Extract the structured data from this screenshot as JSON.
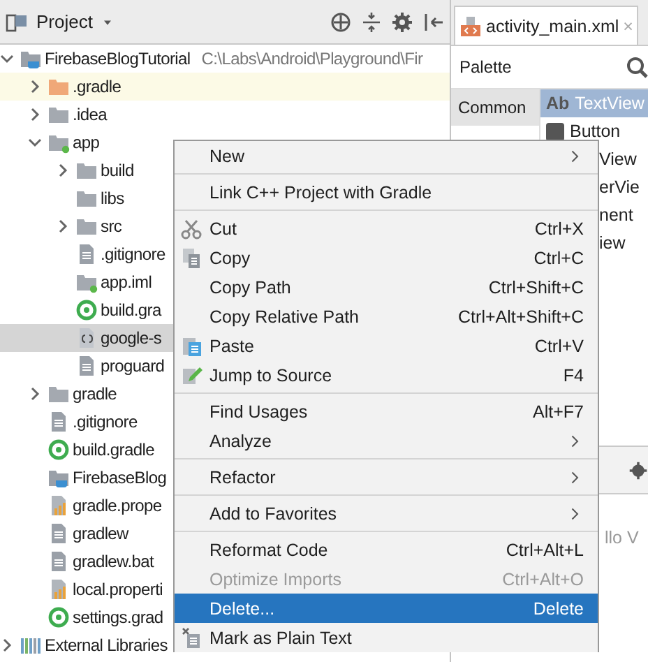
{
  "project_panel": {
    "title": "Project",
    "tree": [
      {
        "kind": "project",
        "label": "FirebaseBlogTutorial",
        "path": "C:\\Labs\\Android\\Playground\\Fir",
        "expanded": true,
        "selected": false,
        "highlighted": false,
        "children": [
          {
            "kind": "excluded-folder",
            "label": ".gradle",
            "expanded": false,
            "selected": false,
            "highlighted": true
          },
          {
            "kind": "folder",
            "label": ".idea",
            "expanded": false,
            "selected": false,
            "highlighted": false
          },
          {
            "kind": "module",
            "label": "app",
            "expanded": true,
            "selected": false,
            "highlighted": false,
            "children": [
              {
                "kind": "folder",
                "label": "build",
                "expanded": false,
                "selected": false,
                "highlighted": false
              },
              {
                "kind": "folder",
                "label": "libs",
                "selected": false,
                "highlighted": false
              },
              {
                "kind": "folder",
                "label": "src",
                "expanded": false,
                "selected": false,
                "highlighted": false
              },
              {
                "kind": "file",
                "label": ".gitignore",
                "selected": false,
                "highlighted": false
              },
              {
                "kind": "module",
                "label": "app.iml",
                "selected": false,
                "highlighted": false
              },
              {
                "kind": "gradle",
                "label": "build.gra",
                "selected": false,
                "highlighted": false
              },
              {
                "kind": "json",
                "label": "google-s",
                "selected": true,
                "highlighted": false
              },
              {
                "kind": "file",
                "label": "proguard",
                "selected": false,
                "highlighted": false
              }
            ]
          },
          {
            "kind": "folder",
            "label": "gradle",
            "expanded": false,
            "selected": false,
            "highlighted": false
          },
          {
            "kind": "file",
            "label": ".gitignore",
            "selected": false,
            "highlighted": false
          },
          {
            "kind": "gradle",
            "label": "build.gradle",
            "selected": false,
            "highlighted": false
          },
          {
            "kind": "project",
            "label": "FirebaseBlog",
            "selected": false,
            "highlighted": false
          },
          {
            "kind": "properties",
            "label": "gradle.prope",
            "selected": false,
            "highlighted": false
          },
          {
            "kind": "file",
            "label": "gradlew",
            "selected": false,
            "highlighted": false
          },
          {
            "kind": "file",
            "label": "gradlew.bat",
            "selected": false,
            "highlighted": false
          },
          {
            "kind": "properties",
            "label": "local.properti",
            "selected": false,
            "highlighted": false
          },
          {
            "kind": "gradle",
            "label": "settings.grad",
            "selected": false,
            "highlighted": false
          }
        ]
      },
      {
        "kind": "libraries",
        "label": "External Libraries",
        "expanded": false,
        "selected": false,
        "highlighted": false
      }
    ]
  },
  "editor": {
    "tab": {
      "label": "activity_main.xml",
      "close": "×"
    },
    "palette_title": "Palette",
    "category": "Common",
    "palette_items": [
      {
        "kind": "ghost",
        "label": "TextView",
        "prefix": "Ab"
      },
      {
        "kind": "widget",
        "label": "Button"
      },
      {
        "kind": "partial",
        "label": "View"
      },
      {
        "kind": "partial",
        "label": "erVie"
      },
      {
        "kind": "partial",
        "label": "nent"
      },
      {
        "kind": "partial",
        "label": "iew"
      }
    ],
    "preview_text": "llo V"
  },
  "context_menu": {
    "groups": [
      [
        {
          "label": "New",
          "submenu": true,
          "disabled": false,
          "selected": false
        }
      ],
      [
        {
          "label": "Link C++ Project with Gradle",
          "disabled": false,
          "selected": false
        }
      ],
      [
        {
          "label": "Cut",
          "kind": "cut",
          "shortcut": "Ctrl+X",
          "disabled": false,
          "selected": false
        },
        {
          "label": "Copy",
          "kind": "copy",
          "shortcut": "Ctrl+C",
          "disabled": false,
          "selected": false
        },
        {
          "label": "Copy Path",
          "shortcut": "Ctrl+Shift+C",
          "disabled": false,
          "selected": false
        },
        {
          "label": "Copy Relative Path",
          "shortcut": "Ctrl+Alt+Shift+C",
          "disabled": false,
          "selected": false
        },
        {
          "label": "Paste",
          "kind": "paste",
          "shortcut": "Ctrl+V",
          "disabled": false,
          "selected": false
        },
        {
          "label": "Jump to Source",
          "kind": "edit",
          "shortcut": "F4",
          "disabled": false,
          "selected": false
        }
      ],
      [
        {
          "label": "Find Usages",
          "shortcut": "Alt+F7",
          "disabled": false,
          "selected": false
        },
        {
          "label": "Analyze",
          "submenu": true,
          "disabled": false,
          "selected": false
        }
      ],
      [
        {
          "label": "Refactor",
          "submenu": true,
          "disabled": false,
          "selected": false
        }
      ],
      [
        {
          "label": "Add to Favorites",
          "submenu": true,
          "disabled": false,
          "selected": false
        }
      ],
      [
        {
          "label": "Reformat Code",
          "shortcut": "Ctrl+Alt+L",
          "disabled": false,
          "selected": false
        },
        {
          "label": "Optimize Imports",
          "shortcut": "Ctrl+Alt+O",
          "disabled": true,
          "selected": false
        },
        {
          "label": "Delete...",
          "shortcut": "Delete",
          "disabled": false,
          "selected": true
        },
        {
          "label": "Mark as Plain Text",
          "kind": "plain",
          "disabled": false,
          "selected": false
        }
      ]
    ]
  }
}
